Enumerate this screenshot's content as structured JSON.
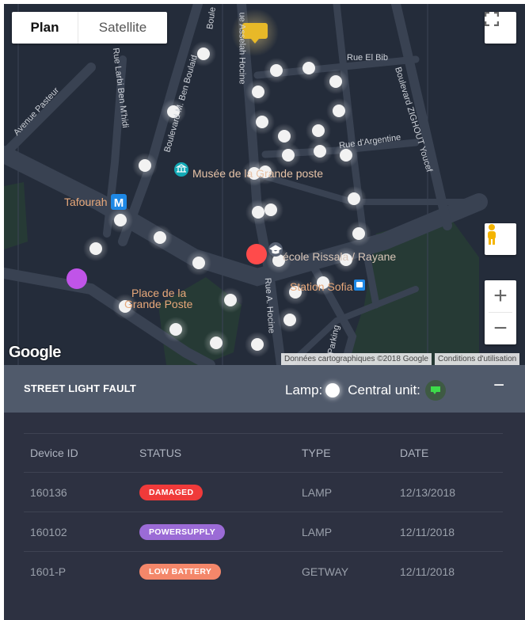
{
  "map": {
    "type_control": {
      "plan_label": "Plan",
      "satellite_label": "Satellite"
    },
    "zoom": {
      "in_label": "+",
      "out_label": "−"
    },
    "google_logo": "Google",
    "attribution": "Données cartographiques ©2018 Google",
    "terms": "Conditions d'utilisation",
    "places": [
      {
        "key": "musee",
        "label": "Musée de la Grande poste"
      },
      {
        "key": "tafourah",
        "label": "Tafourah"
      },
      {
        "key": "ecole",
        "label": "école Rissala / Rayane"
      },
      {
        "key": "station",
        "label": "Station Sofia"
      },
      {
        "key": "place1",
        "label": "Place de la"
      },
      {
        "key": "place2",
        "label": "Grande Poste"
      }
    ],
    "streets": [
      {
        "key": "bib",
        "label": "Rue El Bib"
      },
      {
        "key": "argentine",
        "label": "Rue d'Argentine"
      },
      {
        "key": "zighout",
        "label": "Boulevard ZIGHOUT Youcef"
      },
      {
        "key": "larbi",
        "label": "Rue Larbi Ben M'hidi"
      },
      {
        "key": "boulard",
        "label": "Boulevard M. Ben Boulaid"
      },
      {
        "key": "pasteur",
        "label": "Avenue Pasteur"
      },
      {
        "key": "hocine1",
        "label": "ue Asselah Hocine"
      },
      {
        "key": "hocine2",
        "label": "Rue A. Hocine"
      },
      {
        "key": "boule",
        "label": "Boule"
      },
      {
        "key": "parking",
        "label": "Parking"
      }
    ],
    "colors": {
      "lamp": "#ffffff",
      "fault_red": "#ff4b4b",
      "power_purple": "#c054e8",
      "central_unit": "#e8b928"
    }
  },
  "panel": {
    "title": "STREET LIGHT FAULT",
    "legend_lamp": "Lamp:",
    "legend_central": "Central unit:",
    "collapse_label": "−",
    "columns": [
      "Device ID",
      "STATUS",
      "TYPE",
      "DATE"
    ],
    "rows": [
      {
        "device_id": "160136",
        "status": "DAMAGED",
        "status_color": "#f03a3a",
        "type": "LAMP",
        "date": "12/13/2018"
      },
      {
        "device_id": "160102",
        "status": "POWERSUPPLY",
        "status_color": "#9b6bd6",
        "type": "LAMP",
        "date": "12/11/2018"
      },
      {
        "device_id": "1601-P",
        "status": "LOW BATTERY",
        "status_color": "#f4876a",
        "type": "GETWAY",
        "date": "12/11/2018"
      }
    ]
  }
}
